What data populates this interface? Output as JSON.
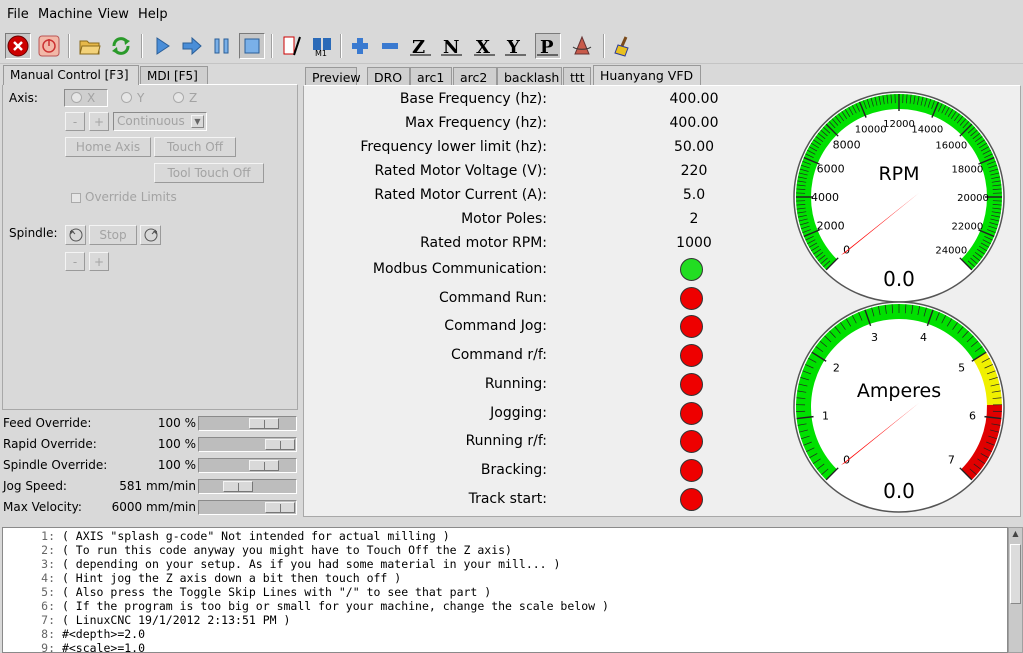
{
  "menu": [
    "File",
    "Machine",
    "View",
    "Help"
  ],
  "left_tabs": [
    {
      "label": "Manual Control [F3]",
      "active": true
    },
    {
      "label": "MDI [F5]",
      "active": false
    }
  ],
  "manual": {
    "axis_label": "Axis:",
    "axes": [
      "X",
      "Y",
      "Z"
    ],
    "minus": "-",
    "plus": "+",
    "jog_mode": "Continuous",
    "home_axis": "Home Axis",
    "touch_off": "Touch Off",
    "tool_touch_off": "Tool Touch Off",
    "override_limits": "Override Limits",
    "spindle_label": "Spindle:",
    "spindle_stop": "Stop"
  },
  "overrides": [
    {
      "label": "Feed Override:",
      "value": "100 %",
      "level": 0.75
    },
    {
      "label": "Rapid Override:",
      "value": "100 %",
      "level": 1.0
    },
    {
      "label": "Spindle Override:",
      "value": "100 %",
      "level": 0.75
    },
    {
      "label": "Jog Speed:",
      "value": "581 mm/min",
      "level": 0.35
    },
    {
      "label": "Max Velocity:",
      "value": "6000 mm/min",
      "level": 1.0
    }
  ],
  "right_tabs": [
    {
      "label": "Preview",
      "active": false
    },
    {
      "label": "DRO",
      "active": false
    },
    {
      "label": "arc1",
      "active": false
    },
    {
      "label": "arc2",
      "active": false
    },
    {
      "label": "backlash",
      "active": false
    },
    {
      "label": "ttt",
      "active": false
    },
    {
      "label": "Huanyang VFD",
      "active": true
    }
  ],
  "vfd": {
    "params": [
      {
        "label": "Base Frequency (hz):",
        "value": "400.00"
      },
      {
        "label": "Max Frequency (hz):",
        "value": "400.00"
      },
      {
        "label": "Frequency lower limit (hz):",
        "value": "50.00"
      },
      {
        "label": "Rated Motor Voltage (V):",
        "value": "220"
      },
      {
        "label": "Rated Motor Current (A):",
        "value": "5.0"
      },
      {
        "label": "Motor Poles:",
        "value": "2"
      },
      {
        "label": "Rated motor RPM:",
        "value": "1000"
      }
    ],
    "status": [
      {
        "label": "Modbus Communication:",
        "state": "green"
      },
      {
        "label": "Command Run:",
        "state": "red"
      },
      {
        "label": "Command Jog:",
        "state": "red"
      },
      {
        "label": "Command r/f:",
        "state": "red"
      },
      {
        "label": "Running:",
        "state": "red"
      },
      {
        "label": "Jogging:",
        "state": "red"
      },
      {
        "label": "Running r/f:",
        "state": "red"
      },
      {
        "label": "Bracking:",
        "state": "red"
      },
      {
        "label": "Track start:",
        "state": "red"
      }
    ]
  },
  "gauges": {
    "rpm": {
      "title": "RPM",
      "value": "0.0",
      "value_num": 0,
      "min": 0,
      "max": 24000,
      "ticks": [
        "0",
        "2000",
        "4000",
        "6000",
        "8000",
        "10000",
        "12000",
        "14000",
        "16000",
        "18000",
        "20000",
        "22000",
        "24000"
      ],
      "zones": [
        {
          "from": 0,
          "to": 24000,
          "color": "#00e000"
        }
      ]
    },
    "amps": {
      "title": "Amperes",
      "value": "0.0",
      "value_num": 0,
      "min": 0,
      "max": 7,
      "ticks": [
        "0",
        "1",
        "2",
        "3",
        "4",
        "5",
        "6",
        "7"
      ],
      "zones": [
        {
          "from": 0,
          "to": 5,
          "color": "#00e000"
        },
        {
          "from": 5,
          "to": 5.8,
          "color": "#f0f000"
        },
        {
          "from": 5.8,
          "to": 7,
          "color": "#e00000"
        }
      ]
    }
  },
  "gcode": [
    {
      "n": "1:",
      "text": "( AXIS \"splash g-code\" Not intended for actual milling )"
    },
    {
      "n": "2:",
      "text": "( To run this code anyway you might have to Touch Off the Z axis)"
    },
    {
      "n": "3:",
      "text": "( depending on your setup. As if you had some material in your mill... )"
    },
    {
      "n": "4:",
      "text": "( Hint jog the Z axis down a bit then touch off )"
    },
    {
      "n": "5:",
      "text": "( Also press the Toggle Skip Lines with \"/\" to see that part )"
    },
    {
      "n": "6:",
      "text": "( If the program is too big or small for your machine, change the scale below )"
    },
    {
      "n": "7:",
      "text": "( LinuxCNC 19/1/2012 2:13:51 PM )"
    },
    {
      "n": "8:",
      "text": "#<depth>=2.0"
    },
    {
      "n": "9:",
      "text": "#<scale>=1.0"
    }
  ]
}
